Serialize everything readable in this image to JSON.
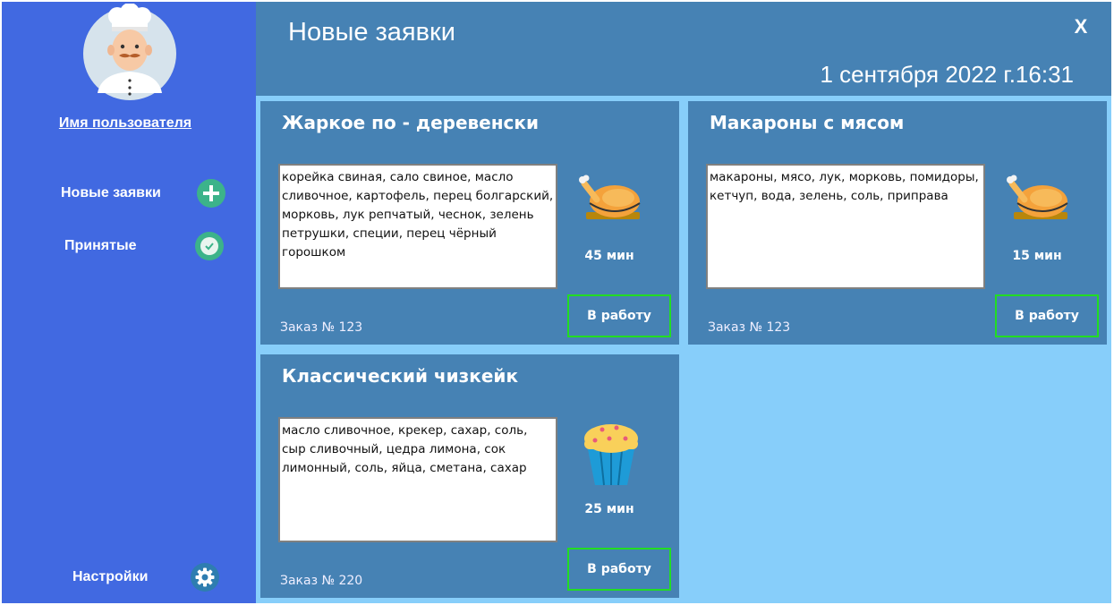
{
  "sidebar": {
    "username": "Имя пользователя",
    "nav": [
      {
        "label": "Новые заявки",
        "icon": "plus-icon"
      },
      {
        "label": "Принятые",
        "icon": "clock-icon"
      }
    ],
    "settings": {
      "label": "Настройки",
      "icon": "gear-icon"
    }
  },
  "header": {
    "title": "Новые заявки",
    "close_label": "X",
    "datetime": "1 сентября 2022 г.16:31"
  },
  "orders": [
    {
      "title": "Жаркое по - деревенски",
      "ingredients": "корейка свиная, сало свиное, масло сливочное, картофель, перец болгарский, морковь, лук репчатый, чеснок, зелень петрушки, специи, перец чёрный горошком",
      "time": "45 мин",
      "order": "Заказ № 123",
      "button": "В работу",
      "icon": "roast-chicken-icon"
    },
    {
      "title": "Макароны с мясом",
      "ingredients": "макароны, мясо, лук, морковь, помидоры, кетчуп, вода, зелень, соль, приправа",
      "time": "15 мин",
      "order": "Заказ № 123",
      "button": "В работу",
      "icon": "roast-chicken-icon"
    },
    {
      "title": "Классический чизкейк",
      "ingredients": "масло сливочное, крекер, сахар, соль, сыр сливочный, цедра лимона, сок лимонный, соль, яйца, сметана, сахар",
      "time": "25 мин",
      "order": "Заказ № 220",
      "button": "В работу",
      "icon": "muffin-icon"
    }
  ],
  "colors": {
    "sidebar": "#4169E1",
    "header": "#4682B4",
    "card": "#4682B4",
    "background": "#87CEFA",
    "button_border": "#22DD22",
    "icon_bg": "#3CB38A"
  }
}
